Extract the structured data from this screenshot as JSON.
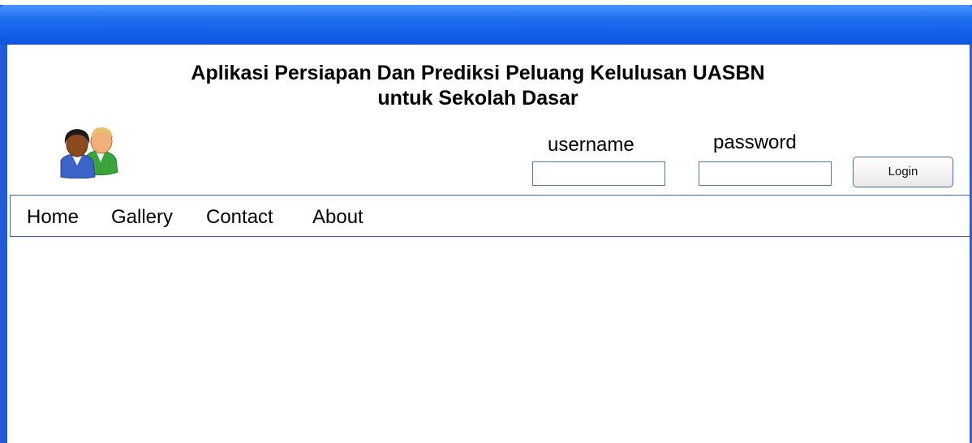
{
  "header": {
    "title_line1": "Aplikasi Persiapan Dan Prediksi Peluang Kelulusan UASBN",
    "title_line2": "untuk Sekolah Dasar",
    "avatar_icon": "users-icon"
  },
  "login": {
    "username_label": "username",
    "password_label": "password",
    "username_value": "",
    "password_value": "",
    "button_label": "Login"
  },
  "nav": {
    "items": [
      "Home",
      "Gallery",
      "Contact",
      "About"
    ]
  },
  "colors": {
    "titlebar": "#1f6ff0",
    "border": "#1f5cd6",
    "input_border": "#4d79b8"
  }
}
